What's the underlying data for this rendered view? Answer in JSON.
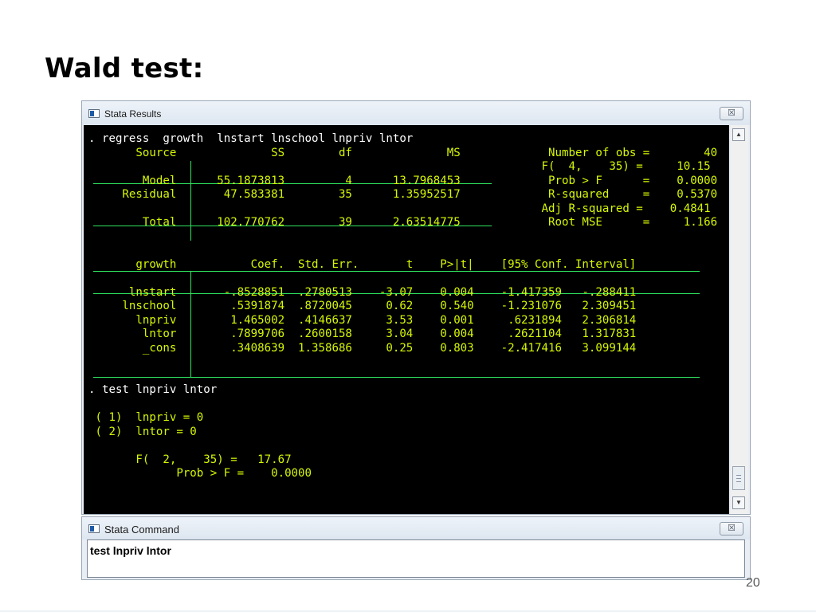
{
  "slide": {
    "title": "Wald test:",
    "page_number": "20"
  },
  "results_window": {
    "title": "Stata Results",
    "close_glyph": "☒",
    "output": {
      "reg_cmd": ". regress  growth  lnstart lnschool lnpriv lntor",
      "anova_header": {
        "source": "Source",
        "ss": "SS",
        "df": "df",
        "ms": "MS",
        "nobs_label": "Number of obs =",
        "nobs_value": "40"
      },
      "anova_rows": [
        {
          "source": "Model",
          "ss": "55.1873813",
          "df": "4",
          "ms": "13.7968453"
        },
        {
          "source": "Residual",
          "ss": "47.583381",
          "df": "35",
          "ms": "1.35952517"
        },
        {
          "source": "Total",
          "ss": "102.770762",
          "df": "39",
          "ms": "2.63514775"
        }
      ],
      "stats": [
        {
          "label": "F(  4,    35) =",
          "value": "10.15"
        },
        {
          "label": "Prob > F      =",
          "value": "0.0000"
        },
        {
          "label": "R-squared     =",
          "value": "0.5370"
        },
        {
          "label": "Adj R-squared =",
          "value": "0.4841"
        },
        {
          "label": "Root MSE      =",
          "value": "1.166"
        }
      ],
      "coef_header": {
        "depvar": "growth",
        "coef": "Coef.",
        "se": "Std. Err.",
        "t": "t",
        "p": "P>|t|",
        "ci": "[95% Conf. Interval]"
      },
      "coef_rows": [
        {
          "var": "lnstart",
          "coef": "-.8528851",
          "se": ".2780513",
          "t": "-3.07",
          "p": "0.004",
          "lo": "-1.417359",
          "hi": "-.288411"
        },
        {
          "var": "lnschool",
          "coef": ".5391874",
          "se": ".8720045",
          "t": "0.62",
          "p": "0.540",
          "lo": "-1.231076",
          "hi": "2.309451"
        },
        {
          "var": "lnpriv",
          "coef": "1.465002",
          "se": ".4146637",
          "t": "3.53",
          "p": "0.001",
          "lo": ".6231894",
          "hi": "2.306814"
        },
        {
          "var": "lntor",
          "coef": ".7899706",
          "se": ".2600158",
          "t": "3.04",
          "p": "0.004",
          "lo": ".2621104",
          "hi": "1.317831"
        },
        {
          "var": "_cons",
          "coef": ".3408639",
          "se": "1.358686",
          "t": "0.25",
          "p": "0.803",
          "lo": "-2.417416",
          "hi": "3.099144"
        }
      ],
      "test_cmd": ". test lnpriv lntor",
      "constraints": [
        "( 1)  lnpriv = 0",
        "( 2)  lntor = 0"
      ],
      "test_f": {
        "label": "F(  2,    35) =",
        "value": "17.67"
      },
      "test_p": {
        "label": "Prob > F =",
        "value": "0.0000"
      }
    }
  },
  "command_window": {
    "title": "Stata Command",
    "close_glyph": "☒",
    "input_value": "test lnpriv lntor"
  },
  "scrollbar": {
    "up_glyph": "▲",
    "down_glyph": "▼"
  },
  "icons": [
    "app-icon",
    "close-icon",
    "scroll-up-icon",
    "scroll-down-icon",
    "scroll-thumb-grip"
  ],
  "colors": {
    "console_bg": "#000000",
    "console_command": "#ffffff",
    "console_text": "#d7f700",
    "console_rules": "#2ee65f",
    "window_chrome": "#e9eef5"
  }
}
